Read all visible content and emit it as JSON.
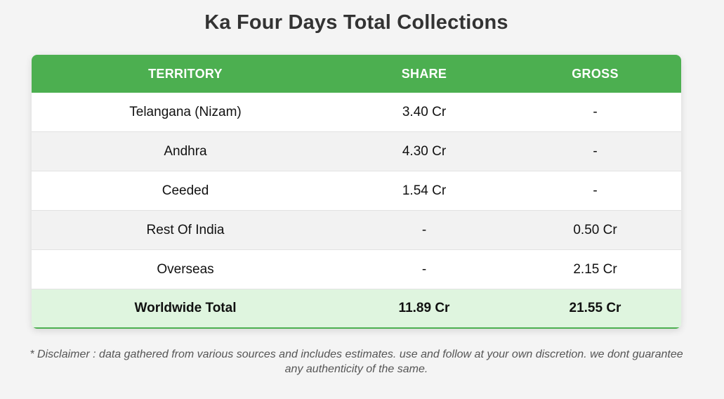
{
  "title": "Ka Four Days Total Collections",
  "table": {
    "headers": [
      "TERRITORY",
      "SHARE",
      "GROSS"
    ],
    "rows": [
      [
        "Telangana (Nizam)",
        "3.40 Cr",
        "-"
      ],
      [
        "Andhra",
        "4.30 Cr",
        "-"
      ],
      [
        "Ceeded",
        "1.54 Cr",
        "-"
      ],
      [
        "Rest Of India",
        "-",
        "0.50 Cr"
      ],
      [
        "Overseas",
        "-",
        "2.15 Cr"
      ]
    ],
    "total": [
      "Worldwide Total",
      "11.89 Cr",
      "21.55 Cr"
    ]
  },
  "disclaimer": "* Disclaimer : data gathered from various sources and includes estimates. use and follow at your own discretion. we dont guarantee any authenticity of the same.",
  "colors": {
    "header_bg": "#4caf50",
    "total_bg": "#dff5df",
    "page_bg": "#f4f4f4"
  }
}
